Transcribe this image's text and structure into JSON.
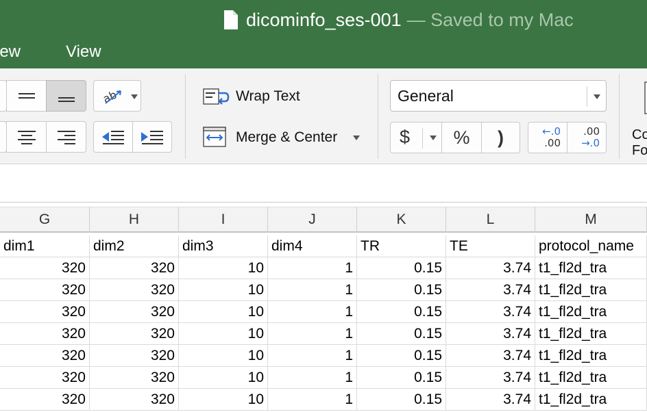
{
  "window": {
    "file_name": "dicominfo_ses-001",
    "save_status": "— Saved to my Mac"
  },
  "tabs": [
    {
      "label": "iew"
    },
    {
      "label": "View"
    }
  ],
  "ribbon": {
    "wrap_text": "Wrap Text",
    "merge_center": "Merge & Center",
    "number_format": "General",
    "currency_symbol": "$",
    "percent_symbol": "%",
    "comma_symbol": ")",
    "increase_decimal_top": "←.0",
    "increase_decimal_bottom": ".00",
    "decrease_decimal_top": ".00",
    "decrease_decimal_bottom": "→.0",
    "conditional_top": "Co",
    "conditional_bottom": "Fo"
  },
  "sheet": {
    "columns": [
      "G",
      "H",
      "I",
      "J",
      "K",
      "L",
      "M"
    ],
    "header_row": [
      "dim1",
      "dim2",
      "dim3",
      "dim4",
      "TR",
      "TE",
      "protocol_name"
    ],
    "rows": [
      [
        "320",
        "320",
        "10",
        "1",
        "0.15",
        "3.74",
        "t1_fl2d_tra"
      ],
      [
        "320",
        "320",
        "10",
        "1",
        "0.15",
        "3.74",
        "t1_fl2d_tra"
      ],
      [
        "320",
        "320",
        "10",
        "1",
        "0.15",
        "3.74",
        "t1_fl2d_tra"
      ],
      [
        "320",
        "320",
        "10",
        "1",
        "0.15",
        "3.74",
        "t1_fl2d_tra"
      ],
      [
        "320",
        "320",
        "10",
        "1",
        "0.15",
        "3.74",
        "t1_fl2d_tra"
      ],
      [
        "320",
        "320",
        "10",
        "1",
        "0.15",
        "3.74",
        "t1_fl2d_tra"
      ],
      [
        "320",
        "320",
        "10",
        "1",
        "0.15",
        "3.74",
        "t1_fl2d_tra"
      ]
    ]
  },
  "colors": {
    "title_bar": "#3b7543",
    "accent_blue": "#2f6fd0"
  }
}
